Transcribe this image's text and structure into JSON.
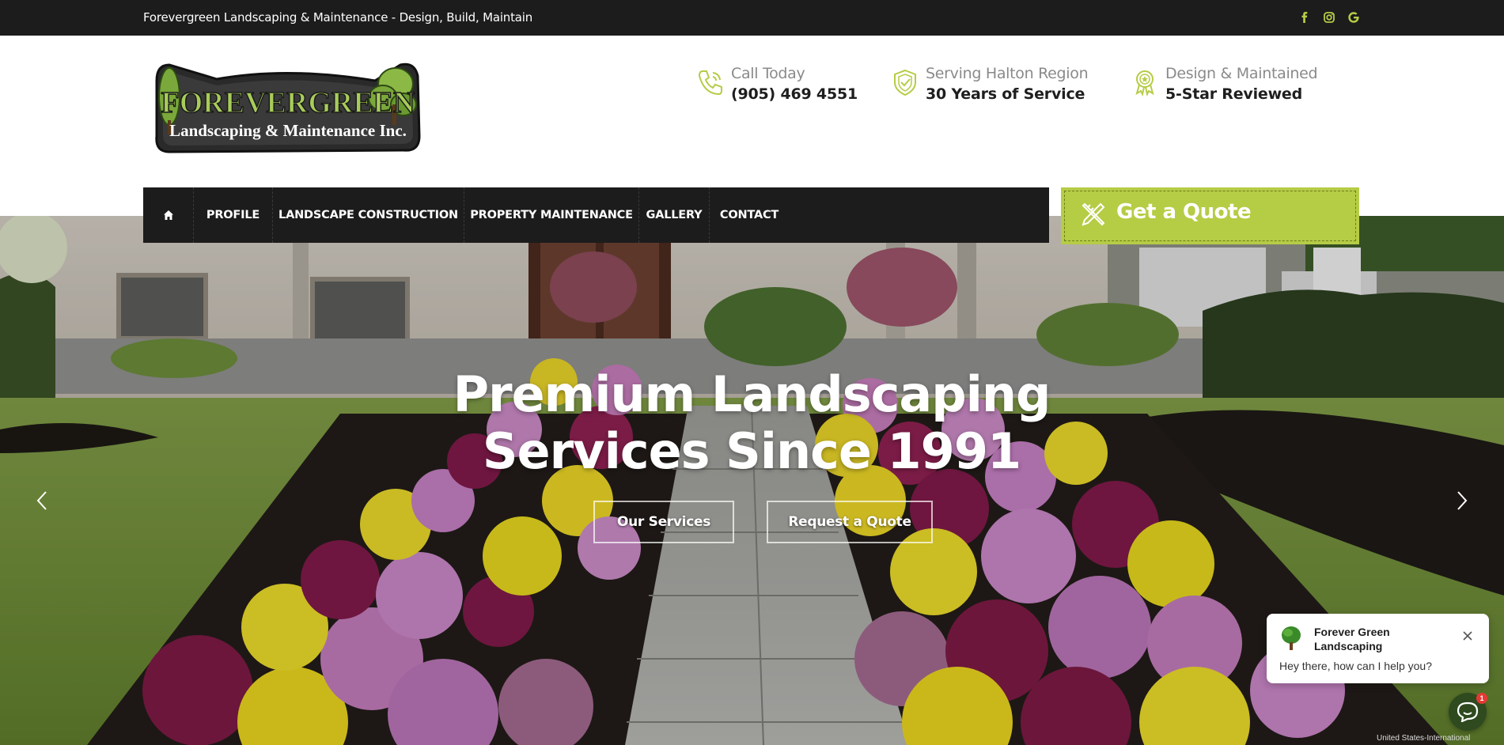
{
  "topbar": {
    "tagline": "Forevergreen Landscaping & Maintenance - Design, Build, Maintain",
    "social": [
      {
        "icon": "facebook-icon",
        "glyph": "f"
      },
      {
        "icon": "instagram-icon",
        "glyph": ""
      },
      {
        "icon": "google-icon",
        "glyph": "G"
      }
    ]
  },
  "logo": {
    "line1": "FOREVERGREEN",
    "line2": "Landscaping & Maintenance Inc."
  },
  "info": [
    {
      "icon": "phone-icon",
      "label": "Call Today",
      "value": "(905) 469 4551"
    },
    {
      "icon": "shield-check-icon",
      "label": "Serving Halton Region",
      "value": "30 Years of Service"
    },
    {
      "icon": "award-ribbon-icon",
      "label": "Design & Maintained",
      "value": "5-Star Reviewed"
    }
  ],
  "nav": {
    "home_icon": "home-icon",
    "items": [
      "PROFILE",
      "LANDSCAPE CONSTRUCTION",
      "PROPERTY MAINTENANCE",
      "GALLERY",
      "CONTACT"
    ]
  },
  "quote": {
    "label": "Get a Quote",
    "icon": "pencil-ruler-icon"
  },
  "hero": {
    "title_line1": "Premium Landscaping",
    "title_line2": "Services Since 1991",
    "buttons": [
      "Our Services",
      "Request a Quote"
    ]
  },
  "chat": {
    "name": "Forever Green Landscaping",
    "message": "Hey there, how can I help you?",
    "badge": "1"
  },
  "footer_note": "United States-International",
  "colors": {
    "accent": "#b5cc45",
    "dark": "#1c1c1c"
  }
}
